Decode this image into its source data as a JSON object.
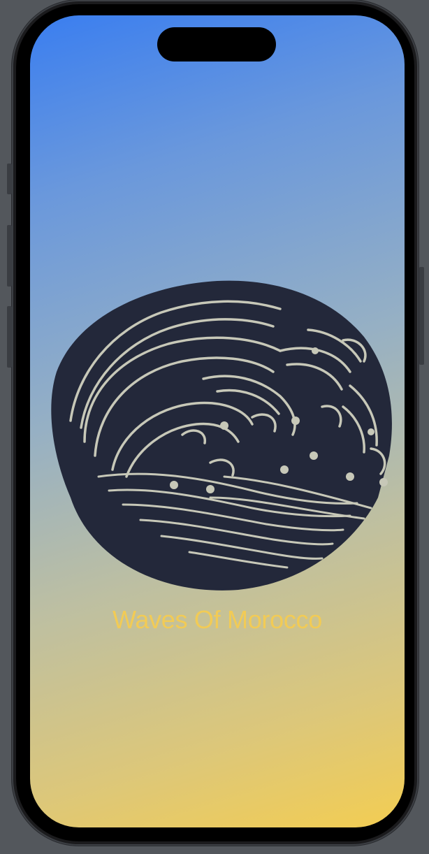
{
  "app": {
    "title": "Waves Of Morocco",
    "logo_icon": "wave-icon"
  },
  "colors": {
    "gradient_top": "#3a7ef0",
    "gradient_bottom": "#f3cd52",
    "title": "#f2cb55",
    "logo": "#23283a",
    "logo_lines": "#c7c8b8"
  }
}
